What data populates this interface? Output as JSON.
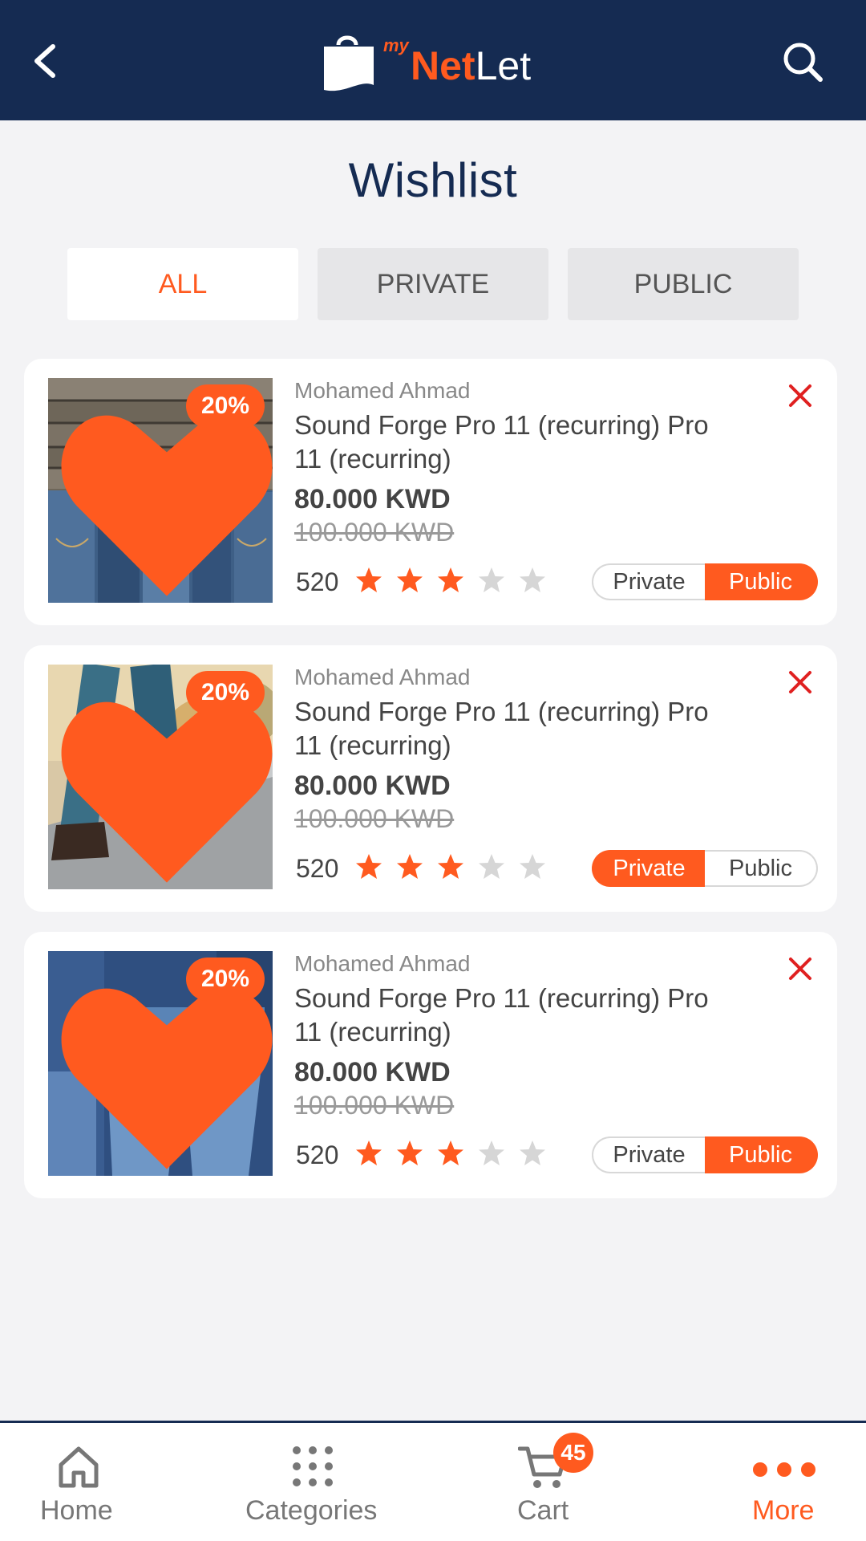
{
  "header": {
    "logo_my": "my",
    "logo_net": "Net",
    "logo_let": "Let",
    "back_icon": "chevron-left-icon",
    "search_icon": "search-icon"
  },
  "page": {
    "title": "Wishlist"
  },
  "tabs": [
    {
      "label": "ALL",
      "active": true
    },
    {
      "label": "PRIVATE",
      "active": false
    },
    {
      "label": "PUBLIC",
      "active": false
    }
  ],
  "products": [
    {
      "seller": "Mohamed Ahmad",
      "name": "Sound Forge Pro 11 (recurring) Pro 11 (recurring)",
      "price": "80.000 KWD",
      "old_price": "100.000 KWD",
      "reviews": "520",
      "rating": 3,
      "max_rating": 5,
      "discount": "20%",
      "visibility": "Public",
      "private_label": "Private",
      "public_label": "Public"
    },
    {
      "seller": "Mohamed Ahmad",
      "name": "Sound Forge Pro 11 (recurring) Pro 11 (recurring)",
      "price": "80.000 KWD",
      "old_price": "100.000 KWD",
      "reviews": "520",
      "rating": 3,
      "max_rating": 5,
      "discount": "20%",
      "visibility": "Private",
      "private_label": "Private",
      "public_label": "Public"
    },
    {
      "seller": "Mohamed Ahmad",
      "name": "Sound Forge Pro 11 (recurring) Pro 11 (recurring)",
      "price": "80.000 KWD",
      "old_price": "100.000 KWD",
      "reviews": "520",
      "rating": 3,
      "max_rating": 5,
      "discount": "20%",
      "visibility": "Public",
      "private_label": "Private",
      "public_label": "Public"
    }
  ],
  "bottom_nav": [
    {
      "label": "Home",
      "icon": "home-icon",
      "active": false
    },
    {
      "label": "Categories",
      "icon": "grid-dots-icon",
      "active": false
    },
    {
      "label": "Cart",
      "icon": "cart-icon",
      "active": false,
      "badge": "45"
    },
    {
      "label": "More",
      "icon": "more-dots-icon",
      "active": true
    }
  ],
  "colors": {
    "accent": "#ff5a1f",
    "header": "#152b52",
    "background": "#f3f3f5"
  }
}
